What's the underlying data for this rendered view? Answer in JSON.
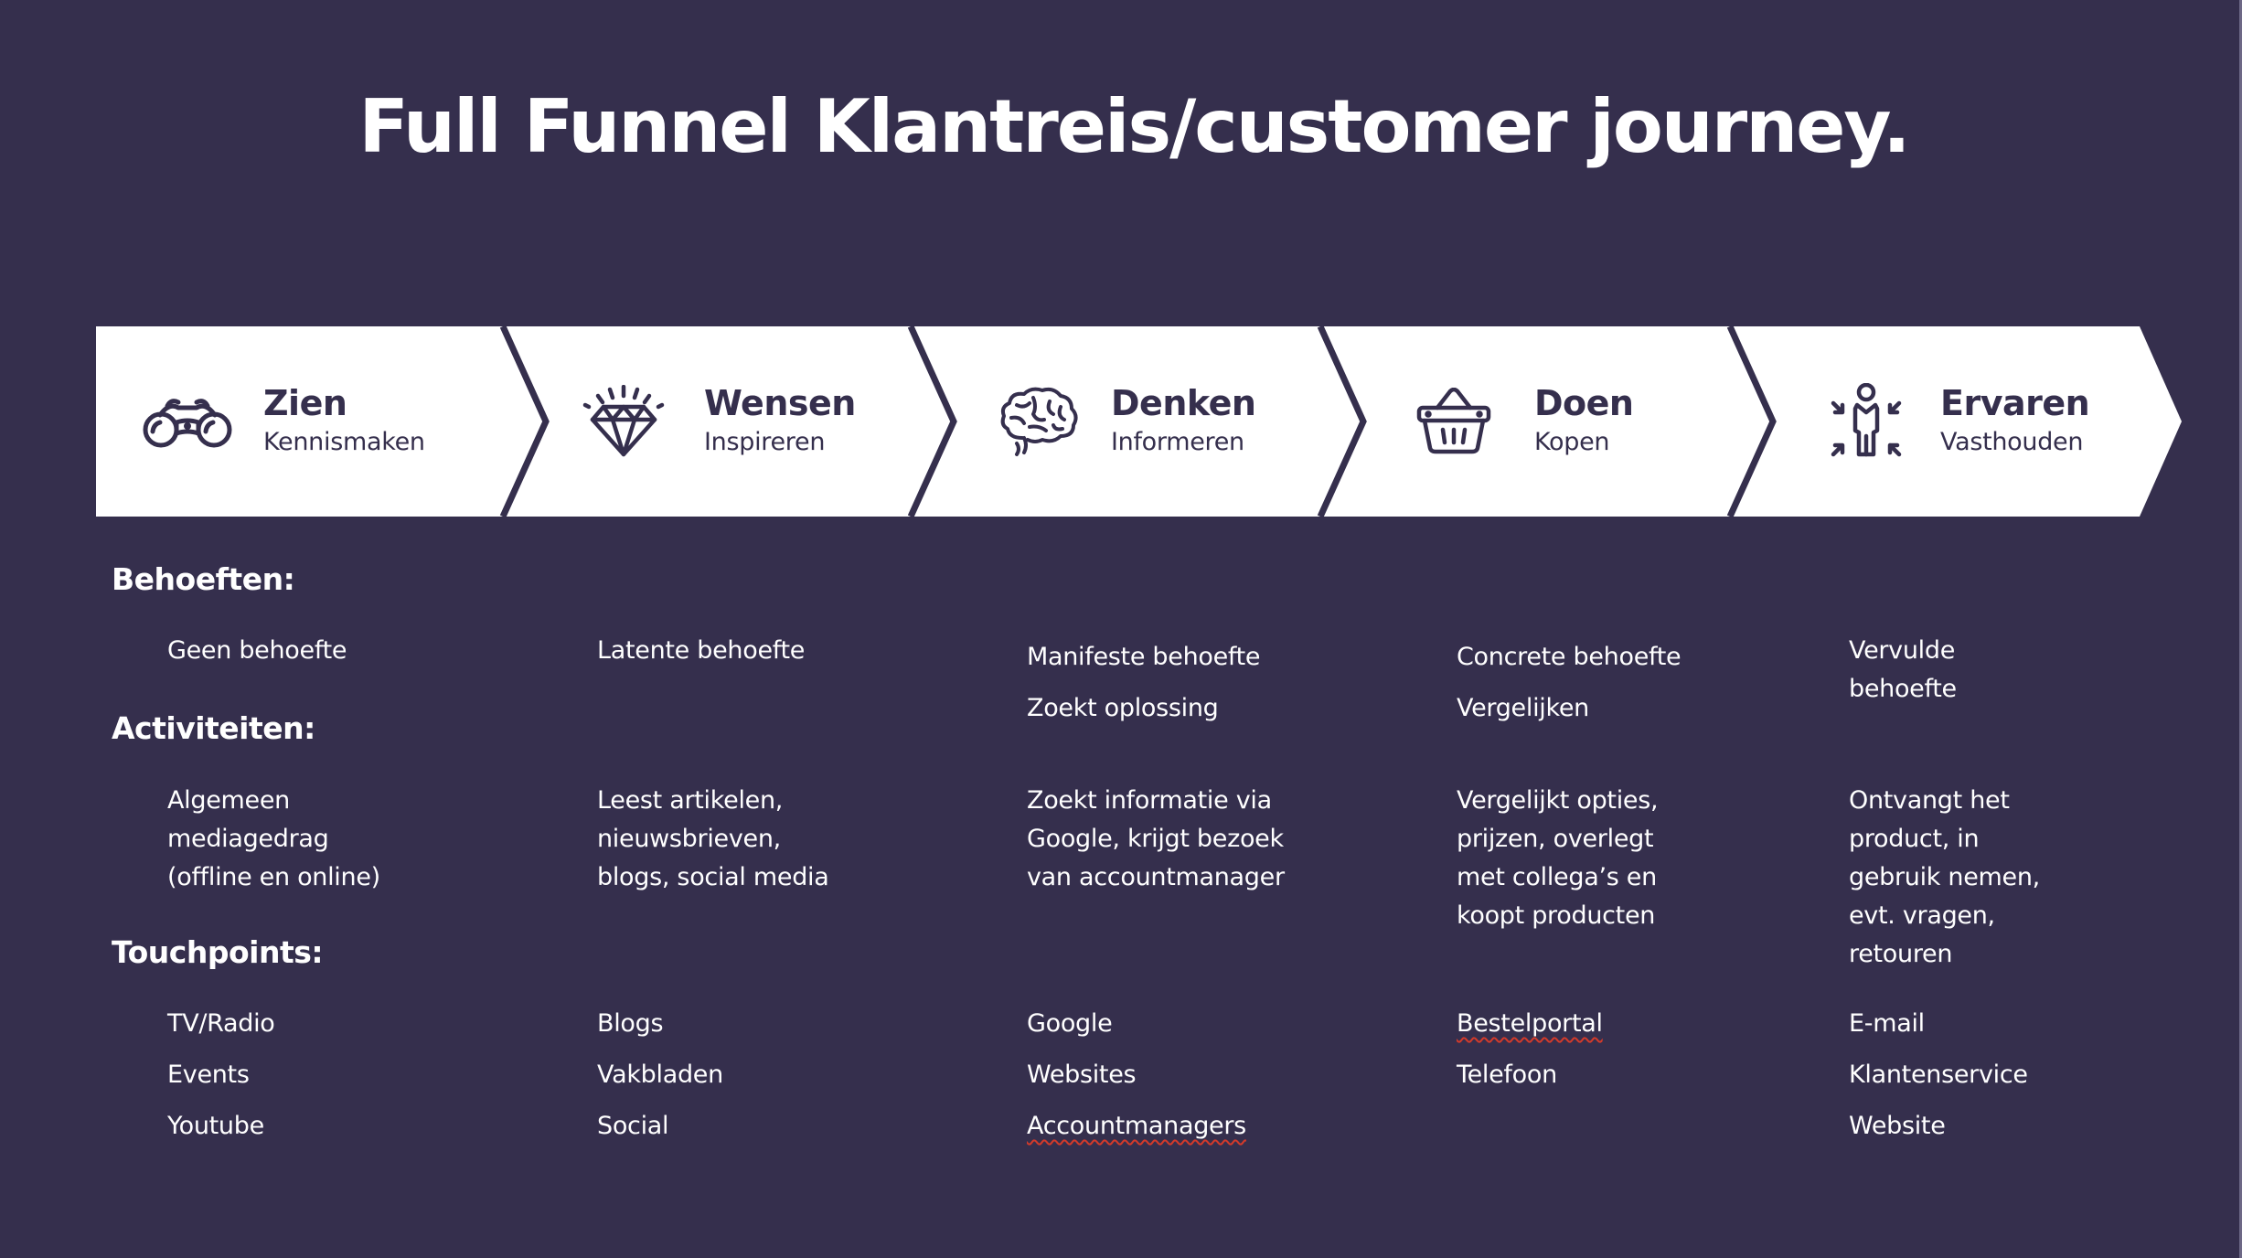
{
  "title": "Full Funnel Klantreis/customer journey.",
  "colors": {
    "background": "#352f4d",
    "band": "#ffffff",
    "ink": "#352f4d",
    "text": "#ffffff",
    "spellcheck": "#d33a2a"
  },
  "stages": [
    {
      "name": "Zien",
      "subtitle": "Kennismaken",
      "icon": "binoculars-icon"
    },
    {
      "name": "Wensen",
      "subtitle": "Inspireren",
      "icon": "diamond-icon"
    },
    {
      "name": "Denken",
      "subtitle": "Informeren",
      "icon": "brain-icon"
    },
    {
      "name": "Doen",
      "subtitle": "Kopen",
      "icon": "basket-icon"
    },
    {
      "name": "Ervaren",
      "subtitle": "Vasthouden",
      "icon": "person-retain-icon"
    }
  ],
  "sections": {
    "behoeften": {
      "heading": "Behoeften:",
      "columns": [
        [
          "Geen behoefte"
        ],
        [
          "Latente behoefte"
        ],
        [
          "Manifeste behoefte",
          "Zoekt oplossing"
        ],
        [
          "Concrete behoefte",
          "Vergelijken"
        ],
        [
          "Vervulde",
          "behoefte"
        ]
      ]
    },
    "activiteiten": {
      "heading": "Activiteiten:",
      "columns": [
        [
          "Algemeen",
          "mediagedrag",
          "(offline en online)"
        ],
        [
          "Leest artikelen,",
          "nieuwsbrieven,",
          "blogs, social media"
        ],
        [
          "Zoekt informatie via",
          "Google, krijgt bezoek",
          "van accountmanager"
        ],
        [
          "Vergelijkt opties,",
          "prijzen, overlegt",
          "met collega’s en",
          "koopt producten"
        ],
        [
          "Ontvangt het",
          "product, in",
          "gebruik nemen,",
          "evt. vragen,",
          "retouren"
        ]
      ]
    },
    "touchpoints": {
      "heading": "Touchpoints:",
      "columns": [
        [
          "TV/Radio",
          "Events",
          "Youtube"
        ],
        [
          "Blogs",
          "Vakbladen",
          "Social"
        ],
        [
          "Google",
          "Websites",
          "Accountmanagers"
        ],
        [
          "Bestelportal",
          "Telefoon"
        ],
        [
          "E-mail",
          "Klantenservice",
          "Website"
        ]
      ]
    }
  }
}
